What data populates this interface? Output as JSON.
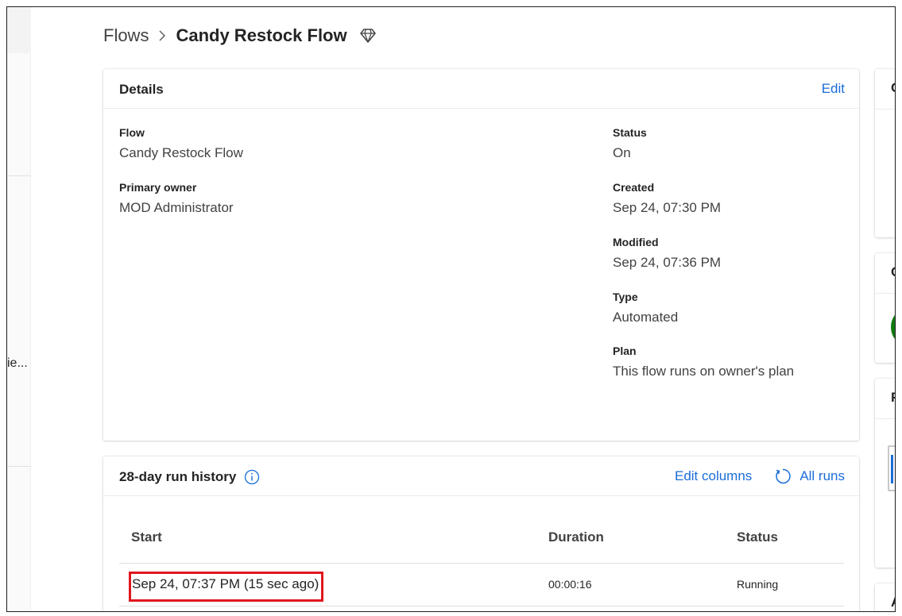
{
  "breadcrumb": {
    "parent": "Flows",
    "current": "Candy Restock Flow",
    "premium_icon": "diamond-icon"
  },
  "left_rail": {
    "truncated_label": "ie..."
  },
  "details": {
    "title": "Details",
    "edit_label": "Edit",
    "flow_label": "Flow",
    "flow_value": "Candy Restock Flow",
    "owner_label": "Primary owner",
    "owner_value": "MOD Administrator",
    "status_label": "Status",
    "status_value": "On",
    "created_label": "Created",
    "created_value": "Sep 24, 07:30 PM",
    "modified_label": "Modified",
    "modified_value": "Sep 24, 07:36 PM",
    "type_label": "Type",
    "type_value": "Automated",
    "plan_label": "Plan",
    "plan_value": "This flow runs on owner's plan"
  },
  "run_history": {
    "title": "28-day run history",
    "info_icon": "info-icon",
    "edit_columns_label": "Edit columns",
    "all_runs_label": "All runs",
    "refresh_icon": "refresh-icon",
    "columns": [
      "Start",
      "Duration",
      "Status"
    ],
    "rows": [
      {
        "start": "Sep 24, 07:37 PM (15 sec ago)",
        "duration": "00:00:16",
        "status": "Running"
      }
    ],
    "highlight_color": "#e0161e"
  },
  "right_column": {
    "card_letters": [
      "C",
      "C",
      "F",
      "A"
    ]
  },
  "colors": {
    "link": "#1a6dd8",
    "text": "#242424",
    "status_green": "#107c10"
  }
}
